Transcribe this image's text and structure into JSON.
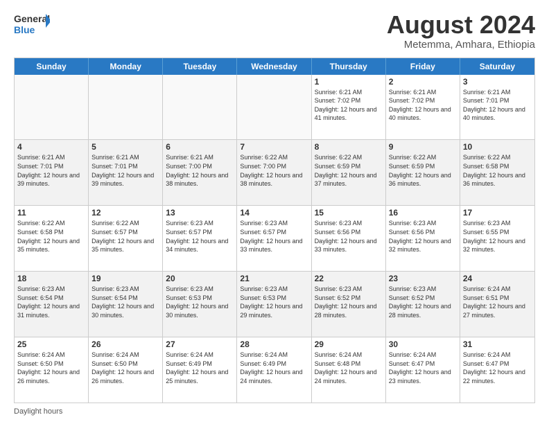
{
  "logo": {
    "line1": "General",
    "line2": "Blue"
  },
  "title": "August 2024",
  "subtitle": "Metemma, Amhara, Ethiopia",
  "days_of_week": [
    "Sunday",
    "Monday",
    "Tuesday",
    "Wednesday",
    "Thursday",
    "Friday",
    "Saturday"
  ],
  "footer": "Daylight hours",
  "weeks": [
    [
      {
        "day": "",
        "empty": true
      },
      {
        "day": "",
        "empty": true
      },
      {
        "day": "",
        "empty": true
      },
      {
        "day": "",
        "empty": true
      },
      {
        "day": "1",
        "info": "Sunrise: 6:21 AM\nSunset: 7:02 PM\nDaylight: 12 hours\nand 41 minutes."
      },
      {
        "day": "2",
        "info": "Sunrise: 6:21 AM\nSunset: 7:02 PM\nDaylight: 12 hours\nand 40 minutes."
      },
      {
        "day": "3",
        "info": "Sunrise: 6:21 AM\nSunset: 7:01 PM\nDaylight: 12 hours\nand 40 minutes."
      }
    ],
    [
      {
        "day": "4",
        "info": "Sunrise: 6:21 AM\nSunset: 7:01 PM\nDaylight: 12 hours\nand 39 minutes."
      },
      {
        "day": "5",
        "info": "Sunrise: 6:21 AM\nSunset: 7:01 PM\nDaylight: 12 hours\nand 39 minutes."
      },
      {
        "day": "6",
        "info": "Sunrise: 6:21 AM\nSunset: 7:00 PM\nDaylight: 12 hours\nand 38 minutes."
      },
      {
        "day": "7",
        "info": "Sunrise: 6:22 AM\nSunset: 7:00 PM\nDaylight: 12 hours\nand 38 minutes."
      },
      {
        "day": "8",
        "info": "Sunrise: 6:22 AM\nSunset: 6:59 PM\nDaylight: 12 hours\nand 37 minutes."
      },
      {
        "day": "9",
        "info": "Sunrise: 6:22 AM\nSunset: 6:59 PM\nDaylight: 12 hours\nand 36 minutes."
      },
      {
        "day": "10",
        "info": "Sunrise: 6:22 AM\nSunset: 6:58 PM\nDaylight: 12 hours\nand 36 minutes."
      }
    ],
    [
      {
        "day": "11",
        "info": "Sunrise: 6:22 AM\nSunset: 6:58 PM\nDaylight: 12 hours\nand 35 minutes."
      },
      {
        "day": "12",
        "info": "Sunrise: 6:22 AM\nSunset: 6:57 PM\nDaylight: 12 hours\nand 35 minutes."
      },
      {
        "day": "13",
        "info": "Sunrise: 6:23 AM\nSunset: 6:57 PM\nDaylight: 12 hours\nand 34 minutes."
      },
      {
        "day": "14",
        "info": "Sunrise: 6:23 AM\nSunset: 6:57 PM\nDaylight: 12 hours\nand 33 minutes."
      },
      {
        "day": "15",
        "info": "Sunrise: 6:23 AM\nSunset: 6:56 PM\nDaylight: 12 hours\nand 33 minutes."
      },
      {
        "day": "16",
        "info": "Sunrise: 6:23 AM\nSunset: 6:56 PM\nDaylight: 12 hours\nand 32 minutes."
      },
      {
        "day": "17",
        "info": "Sunrise: 6:23 AM\nSunset: 6:55 PM\nDaylight: 12 hours\nand 32 minutes."
      }
    ],
    [
      {
        "day": "18",
        "info": "Sunrise: 6:23 AM\nSunset: 6:54 PM\nDaylight: 12 hours\nand 31 minutes."
      },
      {
        "day": "19",
        "info": "Sunrise: 6:23 AM\nSunset: 6:54 PM\nDaylight: 12 hours\nand 30 minutes."
      },
      {
        "day": "20",
        "info": "Sunrise: 6:23 AM\nSunset: 6:53 PM\nDaylight: 12 hours\nand 30 minutes."
      },
      {
        "day": "21",
        "info": "Sunrise: 6:23 AM\nSunset: 6:53 PM\nDaylight: 12 hours\nand 29 minutes."
      },
      {
        "day": "22",
        "info": "Sunrise: 6:23 AM\nSunset: 6:52 PM\nDaylight: 12 hours\nand 28 minutes."
      },
      {
        "day": "23",
        "info": "Sunrise: 6:23 AM\nSunset: 6:52 PM\nDaylight: 12 hours\nand 28 minutes."
      },
      {
        "day": "24",
        "info": "Sunrise: 6:24 AM\nSunset: 6:51 PM\nDaylight: 12 hours\nand 27 minutes."
      }
    ],
    [
      {
        "day": "25",
        "info": "Sunrise: 6:24 AM\nSunset: 6:50 PM\nDaylight: 12 hours\nand 26 minutes."
      },
      {
        "day": "26",
        "info": "Sunrise: 6:24 AM\nSunset: 6:50 PM\nDaylight: 12 hours\nand 26 minutes."
      },
      {
        "day": "27",
        "info": "Sunrise: 6:24 AM\nSunset: 6:49 PM\nDaylight: 12 hours\nand 25 minutes."
      },
      {
        "day": "28",
        "info": "Sunrise: 6:24 AM\nSunset: 6:49 PM\nDaylight: 12 hours\nand 24 minutes."
      },
      {
        "day": "29",
        "info": "Sunrise: 6:24 AM\nSunset: 6:48 PM\nDaylight: 12 hours\nand 24 minutes."
      },
      {
        "day": "30",
        "info": "Sunrise: 6:24 AM\nSunset: 6:47 PM\nDaylight: 12 hours\nand 23 minutes."
      },
      {
        "day": "31",
        "info": "Sunrise: 6:24 AM\nSunset: 6:47 PM\nDaylight: 12 hours\nand 22 minutes."
      }
    ]
  ]
}
